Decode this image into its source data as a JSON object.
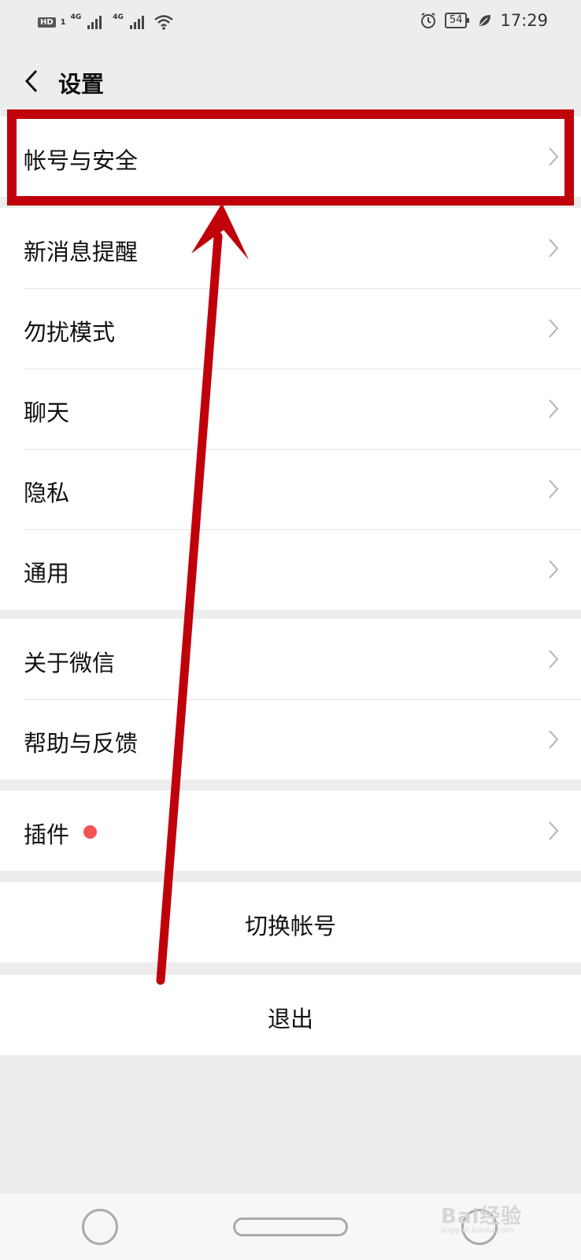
{
  "status_bar": {
    "hd": "HD",
    "sim1": "1",
    "net1": "4G",
    "net2": "4G",
    "battery": "54",
    "time": "17:29"
  },
  "header": {
    "title": "设置"
  },
  "groups": [
    {
      "items": [
        {
          "label": "帐号与安全"
        }
      ]
    },
    {
      "items": [
        {
          "label": "新消息提醒"
        },
        {
          "label": "勿扰模式"
        },
        {
          "label": "聊天"
        },
        {
          "label": "隐私"
        },
        {
          "label": "通用"
        }
      ]
    },
    {
      "items": [
        {
          "label": "关于微信"
        },
        {
          "label": "帮助与反馈"
        }
      ]
    },
    {
      "items": [
        {
          "label": "插件"
        }
      ]
    }
  ],
  "buttons": {
    "switch_account": "切换帐号",
    "logout": "退出"
  },
  "watermark": {
    "brand": "Bai",
    "brand2": "经验",
    "url": "jingyan.baidu.com"
  },
  "colors": {
    "annotation": "#c0000a",
    "badge": "#f05454",
    "background": "#ededed"
  }
}
